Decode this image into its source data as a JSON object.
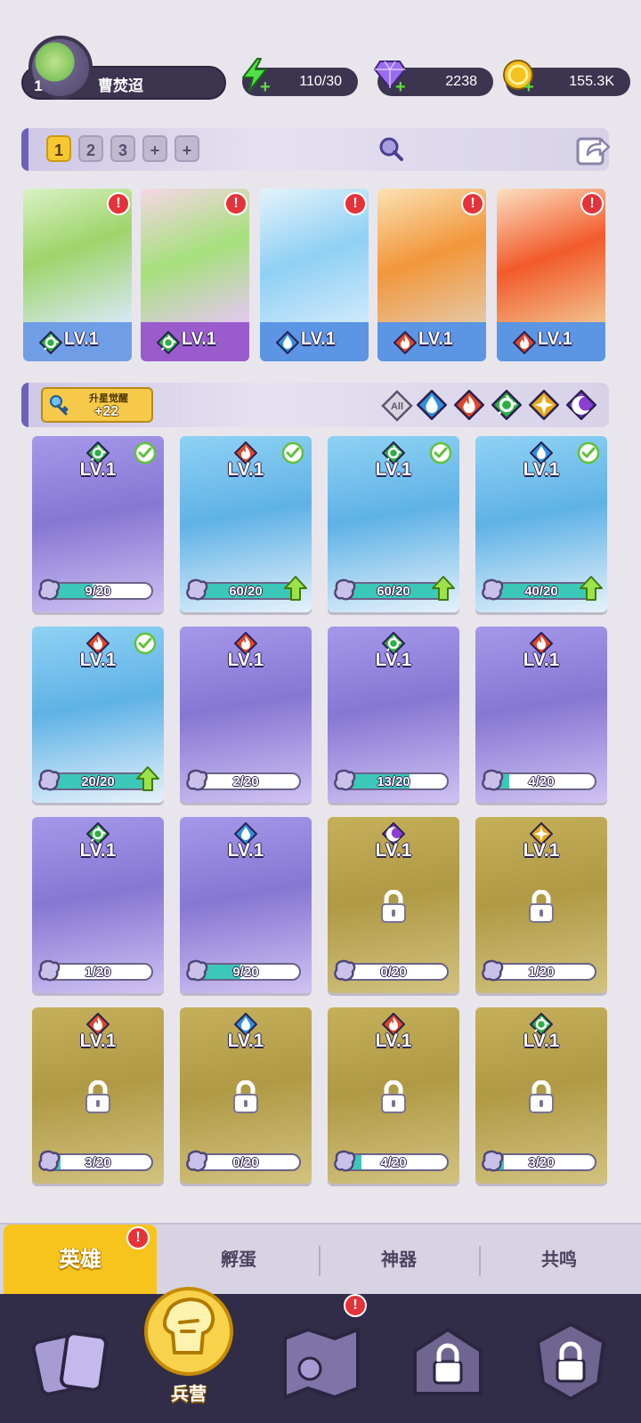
{
  "player": {
    "level": "1",
    "name": "曹焚迢"
  },
  "resources": {
    "energy": "110/30",
    "gems": "2238",
    "coins": "155.3K"
  },
  "team": {
    "slots": [
      "1",
      "2",
      "3",
      "+",
      "+"
    ],
    "active_slot": "1",
    "heroes": [
      {
        "level": "LV.1",
        "element": "nature"
      },
      {
        "level": "LV.1",
        "element": "nature"
      },
      {
        "level": "LV.1",
        "element": "water"
      },
      {
        "level": "LV.1",
        "element": "fire"
      },
      {
        "level": "LV.1",
        "element": "fire"
      }
    ]
  },
  "filter": {
    "awaken_label": "升星觉醒",
    "awaken_count": "+22",
    "all_label": "All",
    "elements": [
      "water",
      "fire",
      "nature",
      "light",
      "dark"
    ]
  },
  "heroes": [
    {
      "level": "LV.1",
      "element": "nature",
      "count": "9/20",
      "progress": 0.45,
      "checked": true,
      "upgrade": false,
      "locked": false,
      "rarity": "epic"
    },
    {
      "level": "LV.1",
      "element": "fire",
      "count": "60/20",
      "progress": 1.0,
      "checked": true,
      "upgrade": true,
      "locked": false,
      "rarity": "rare"
    },
    {
      "level": "LV.1",
      "element": "nature",
      "count": "60/20",
      "progress": 1.0,
      "checked": true,
      "upgrade": true,
      "locked": false,
      "rarity": "rare"
    },
    {
      "level": "LV.1",
      "element": "water",
      "count": "40/20",
      "progress": 1.0,
      "checked": true,
      "upgrade": true,
      "locked": false,
      "rarity": "rare"
    },
    {
      "level": "LV.1",
      "element": "fire",
      "count": "20/20",
      "progress": 1.0,
      "checked": true,
      "upgrade": true,
      "locked": false,
      "rarity": "rare"
    },
    {
      "level": "LV.1",
      "element": "fire",
      "count": "2/20",
      "progress": 0.1,
      "checked": false,
      "upgrade": false,
      "locked": false,
      "rarity": "epic"
    },
    {
      "level": "LV.1",
      "element": "nature",
      "count": "13/20",
      "progress": 0.65,
      "checked": false,
      "upgrade": false,
      "locked": false,
      "rarity": "epic"
    },
    {
      "level": "LV.1",
      "element": "fire",
      "count": "4/20",
      "progress": 0.2,
      "checked": false,
      "upgrade": false,
      "locked": false,
      "rarity": "epic"
    },
    {
      "level": "LV.1",
      "element": "nature",
      "count": "1/20",
      "progress": 0.05,
      "checked": false,
      "upgrade": false,
      "locked": false,
      "rarity": "epic"
    },
    {
      "level": "LV.1",
      "element": "water",
      "count": "9/20",
      "progress": 0.45,
      "checked": false,
      "upgrade": false,
      "locked": false,
      "rarity": "epic"
    },
    {
      "level": "LV.1",
      "element": "dark",
      "count": "0/20",
      "progress": 0.0,
      "checked": false,
      "upgrade": false,
      "locked": true,
      "rarity": "legend"
    },
    {
      "level": "LV.1",
      "element": "light",
      "count": "1/20",
      "progress": 0.05,
      "checked": false,
      "upgrade": false,
      "locked": true,
      "rarity": "legend"
    },
    {
      "level": "LV.1",
      "element": "fire",
      "count": "3/20",
      "progress": 0.15,
      "checked": false,
      "upgrade": false,
      "locked": true,
      "rarity": "legend"
    },
    {
      "level": "LV.1",
      "element": "water",
      "count": "0/20",
      "progress": 0.0,
      "checked": false,
      "upgrade": false,
      "locked": true,
      "rarity": "legend"
    },
    {
      "level": "LV.1",
      "element": "fire",
      "count": "4/20",
      "progress": 0.2,
      "checked": false,
      "upgrade": false,
      "locked": true,
      "rarity": "legend"
    },
    {
      "level": "LV.1",
      "element": "nature",
      "count": "3/20",
      "progress": 0.15,
      "checked": false,
      "upgrade": false,
      "locked": true,
      "rarity": "legend"
    }
  ],
  "subtabs": [
    "英雄",
    "孵蛋",
    "神器",
    "共鸣"
  ],
  "bottom_nav": {
    "active_label": "兵营",
    "items": [
      "cards-icon",
      "barracks-icon",
      "map-icon",
      "locked-building-icon",
      "locked-crest-icon"
    ]
  },
  "colors": {
    "fire": "#e0462a",
    "water": "#2f8fe0",
    "nature": "#2fae45",
    "light": "#e8a91c",
    "dark": "#8a3fd0",
    "epic": "#8f7fd8",
    "rare": "#6fb6e8",
    "legend": "#c9a42a"
  }
}
